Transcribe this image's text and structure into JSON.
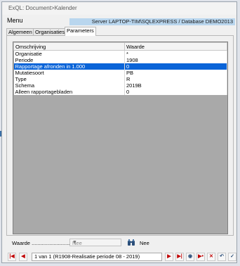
{
  "window": {
    "title": "ExQL: Document>Kalender",
    "menu_label": "Menu",
    "server_info": "Server LAPTOP-TIM\\SQLEXPRESS / Database DEMO2013"
  },
  "tabs": [
    {
      "label": "Algemeen"
    },
    {
      "label": "Organisaties"
    },
    {
      "label": "Parameters",
      "active": true
    }
  ],
  "grid": {
    "headers": [
      "Omschrijving",
      "Waarde"
    ],
    "rows": [
      {
        "omschrijving": "Organisatie",
        "waarde": "*"
      },
      {
        "omschrijving": "Periode",
        "waarde": "1908"
      },
      {
        "omschrijving": "Rapportage afronden in 1.000",
        "waarde": "0",
        "selected": true
      },
      {
        "omschrijving": "Mutatiesoort",
        "waarde": "PB"
      },
      {
        "omschrijving": "Type",
        "waarde": "R"
      },
      {
        "omschrijving": "Schema",
        "waarde": "2019B"
      },
      {
        "omschrijving": "Alleen rapportagebladen",
        "waarde": "0"
      }
    ]
  },
  "waarde": {
    "label": "Waarde ..........................",
    "select_value": "Nee",
    "text": "Nee"
  },
  "navigation": {
    "record": "1 van 1 (R1908-Realisatie periode 08 - 2019)"
  },
  "colors": {
    "selection": "#0a64d8",
    "server_bar": "#b9d6ee",
    "nav_arrow": "#c00000"
  }
}
